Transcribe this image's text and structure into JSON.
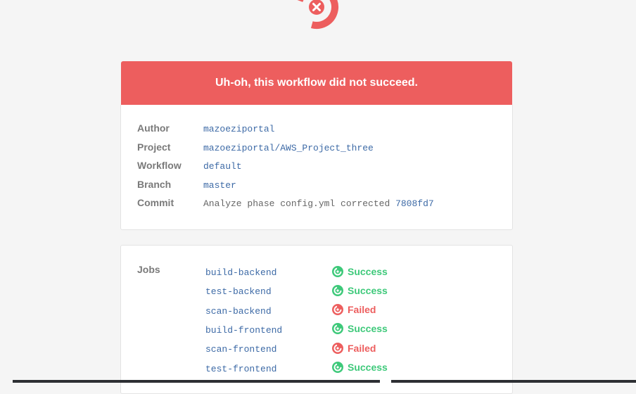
{
  "brand": {
    "logo_icon": "circleci-failed-logo-icon",
    "color": "#ed5e5e"
  },
  "banner": {
    "message": "Uh-oh, this workflow did not succeed."
  },
  "details": {
    "author_label": "Author",
    "author": "mazoeziportal",
    "project_label": "Project",
    "project": "mazoeziportal/AWS_Project_three",
    "workflow_label": "Workflow",
    "workflow": "default",
    "branch_label": "Branch",
    "branch": "master",
    "commit_label": "Commit",
    "commit_message": "Analyze phase config.yml corrected",
    "commit_hash": "7808fd7"
  },
  "jobs": {
    "label": "Jobs",
    "items": [
      {
        "name": "build-backend",
        "status": "Success"
      },
      {
        "name": "test-backend",
        "status": "Success"
      },
      {
        "name": "scan-backend",
        "status": "Failed"
      },
      {
        "name": "build-frontend",
        "status": "Success"
      },
      {
        "name": "scan-frontend",
        "status": "Failed"
      },
      {
        "name": "test-frontend",
        "status": "Success"
      }
    ]
  },
  "colors": {
    "success": "#3ec97a",
    "failed": "#ed5e5e",
    "link": "#3d6aa6"
  }
}
